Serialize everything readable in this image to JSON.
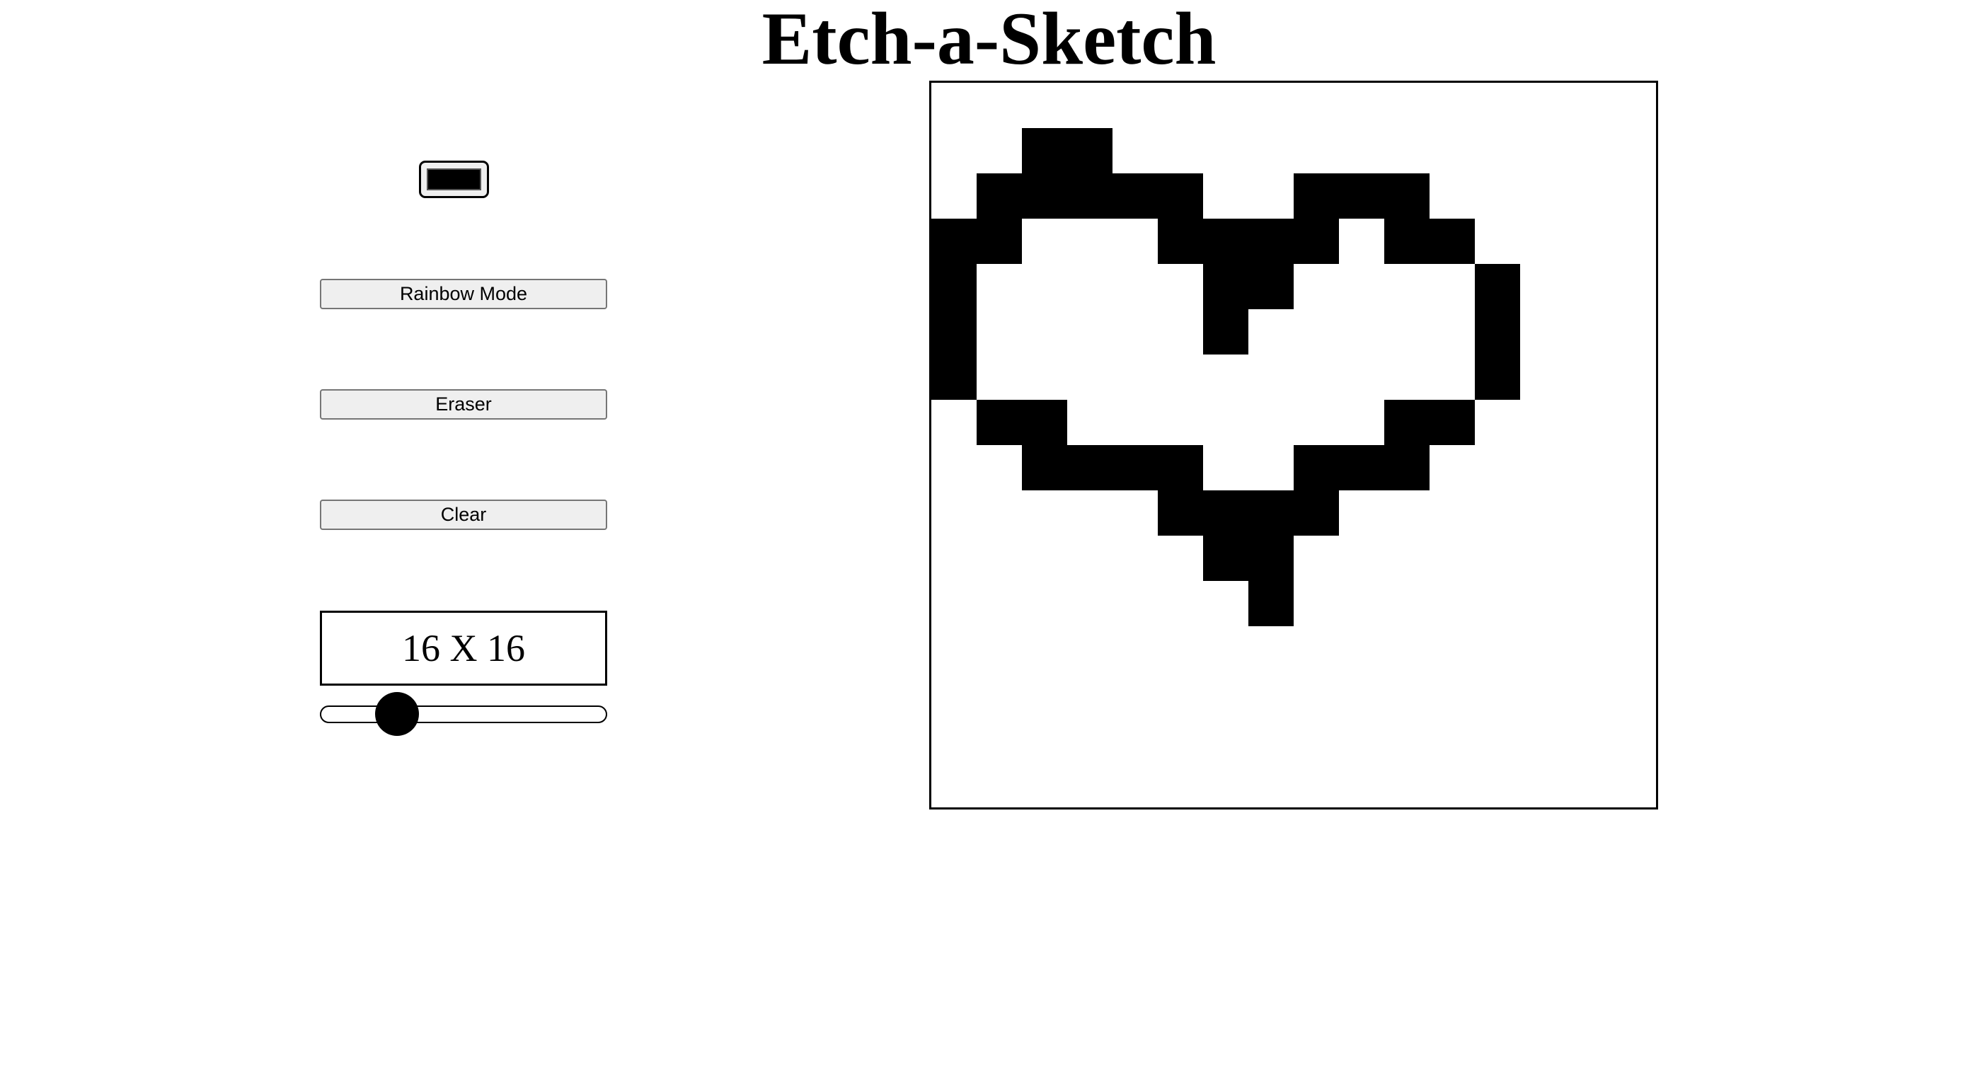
{
  "header": {
    "title": "Etch-a-Sketch"
  },
  "controls": {
    "pen_color": "#000000",
    "rainbow_label": "Rainbow Mode",
    "eraser_label": "Eraser",
    "clear_label": "Clear",
    "size_label": "16 X 16",
    "slider_value": 16,
    "slider_min": 1,
    "slider_max": 64
  },
  "grid": {
    "size": 16,
    "fill_color": "#000000",
    "empty_color": "#ffffff",
    "filled_cells": [
      [
        1,
        2
      ],
      [
        1,
        3
      ],
      [
        2,
        1
      ],
      [
        2,
        2
      ],
      [
        2,
        3
      ],
      [
        2,
        4
      ],
      [
        2,
        5
      ],
      [
        2,
        8
      ],
      [
        2,
        9
      ],
      [
        2,
        10
      ],
      [
        3,
        0
      ],
      [
        3,
        1
      ],
      [
        3,
        5
      ],
      [
        3,
        6
      ],
      [
        3,
        7
      ],
      [
        3,
        8
      ],
      [
        3,
        10
      ],
      [
        3,
        11
      ],
      [
        4,
        0
      ],
      [
        4,
        6
      ],
      [
        4,
        7
      ],
      [
        4,
        12
      ],
      [
        5,
        0
      ],
      [
        5,
        6
      ],
      [
        5,
        12
      ],
      [
        6,
        0
      ],
      [
        6,
        12
      ],
      [
        7,
        1
      ],
      [
        7,
        2
      ],
      [
        7,
        10
      ],
      [
        7,
        11
      ],
      [
        8,
        2
      ],
      [
        8,
        3
      ],
      [
        8,
        4
      ],
      [
        8,
        5
      ],
      [
        8,
        8
      ],
      [
        8,
        9
      ],
      [
        8,
        10
      ],
      [
        9,
        5
      ],
      [
        9,
        6
      ],
      [
        9,
        7
      ],
      [
        9,
        8
      ],
      [
        10,
        6
      ],
      [
        10,
        7
      ],
      [
        11,
        7
      ]
    ]
  }
}
